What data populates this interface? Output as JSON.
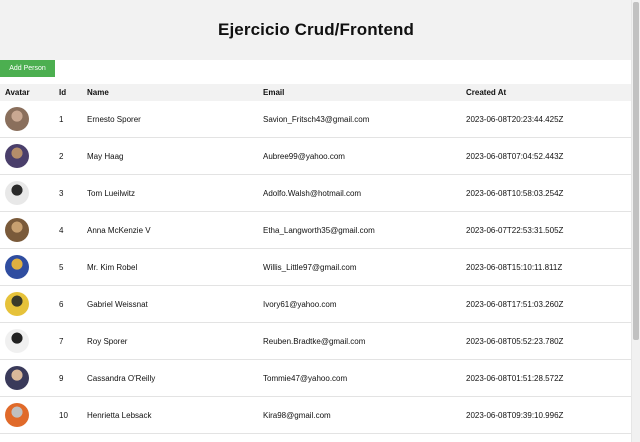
{
  "header": {
    "title": "Ejercicio Crud/Frontend"
  },
  "toolbar": {
    "add_label": "Add Person"
  },
  "table": {
    "columns": [
      "Avatar",
      "Id",
      "Name",
      "Email",
      "Created At"
    ],
    "rows": [
      {
        "id": "1",
        "name": "Ernesto Sporer",
        "email": "Savion_Fritsch43@gmail.com",
        "created": "2023-06-08T20:23:44.425Z",
        "avatar_colors": [
          "#8a6f5c",
          "#c9a892"
        ]
      },
      {
        "id": "2",
        "name": "May Haag",
        "email": "Aubree99@yahoo.com",
        "created": "2023-06-08T07:04:52.443Z",
        "avatar_colors": [
          "#4a3f6b",
          "#b48d6a"
        ]
      },
      {
        "id": "3",
        "name": "Tom Lueilwitz",
        "email": "Adolfo.Walsh@hotmail.com",
        "created": "2023-06-08T10:58:03.254Z",
        "avatar_colors": [
          "#e8e8e8",
          "#2a2a2a"
        ]
      },
      {
        "id": "4",
        "name": "Anna McKenzie V",
        "email": "Etha_Langworth35@gmail.com",
        "created": "2023-06-07T22:53:31.505Z",
        "avatar_colors": [
          "#7a5a3a",
          "#c8a070"
        ]
      },
      {
        "id": "5",
        "name": "Mr. Kim Robel",
        "email": "Willis_Little97@gmail.com",
        "created": "2023-06-08T15:10:11.811Z",
        "avatar_colors": [
          "#2f4da0",
          "#e0b040"
        ]
      },
      {
        "id": "6",
        "name": "Gabriel Weissnat",
        "email": "Ivory61@yahoo.com",
        "created": "2023-06-08T17:51:03.260Z",
        "avatar_colors": [
          "#e6c23a",
          "#3a3a2a"
        ]
      },
      {
        "id": "7",
        "name": "Roy Sporer",
        "email": "Reuben.Bradtke@gmail.com",
        "created": "2023-06-08T05:52:23.780Z",
        "avatar_colors": [
          "#f0f0f0",
          "#222222"
        ]
      },
      {
        "id": "9",
        "name": "Cassandra O'Reilly",
        "email": "Tommie47@yahoo.com",
        "created": "2023-06-08T01:51:28.572Z",
        "avatar_colors": [
          "#3a3a5a",
          "#d9b89a"
        ]
      },
      {
        "id": "10",
        "name": "Henrietta Lebsack",
        "email": "Kira98@gmail.com",
        "created": "2023-06-08T09:39:10.996Z",
        "avatar_colors": [
          "#e06a2a",
          "#c0c0c0"
        ]
      }
    ]
  },
  "colors": {
    "accent": "#4caf50",
    "header_bg": "#f2f2f2",
    "row_border": "#e3e3e3"
  }
}
